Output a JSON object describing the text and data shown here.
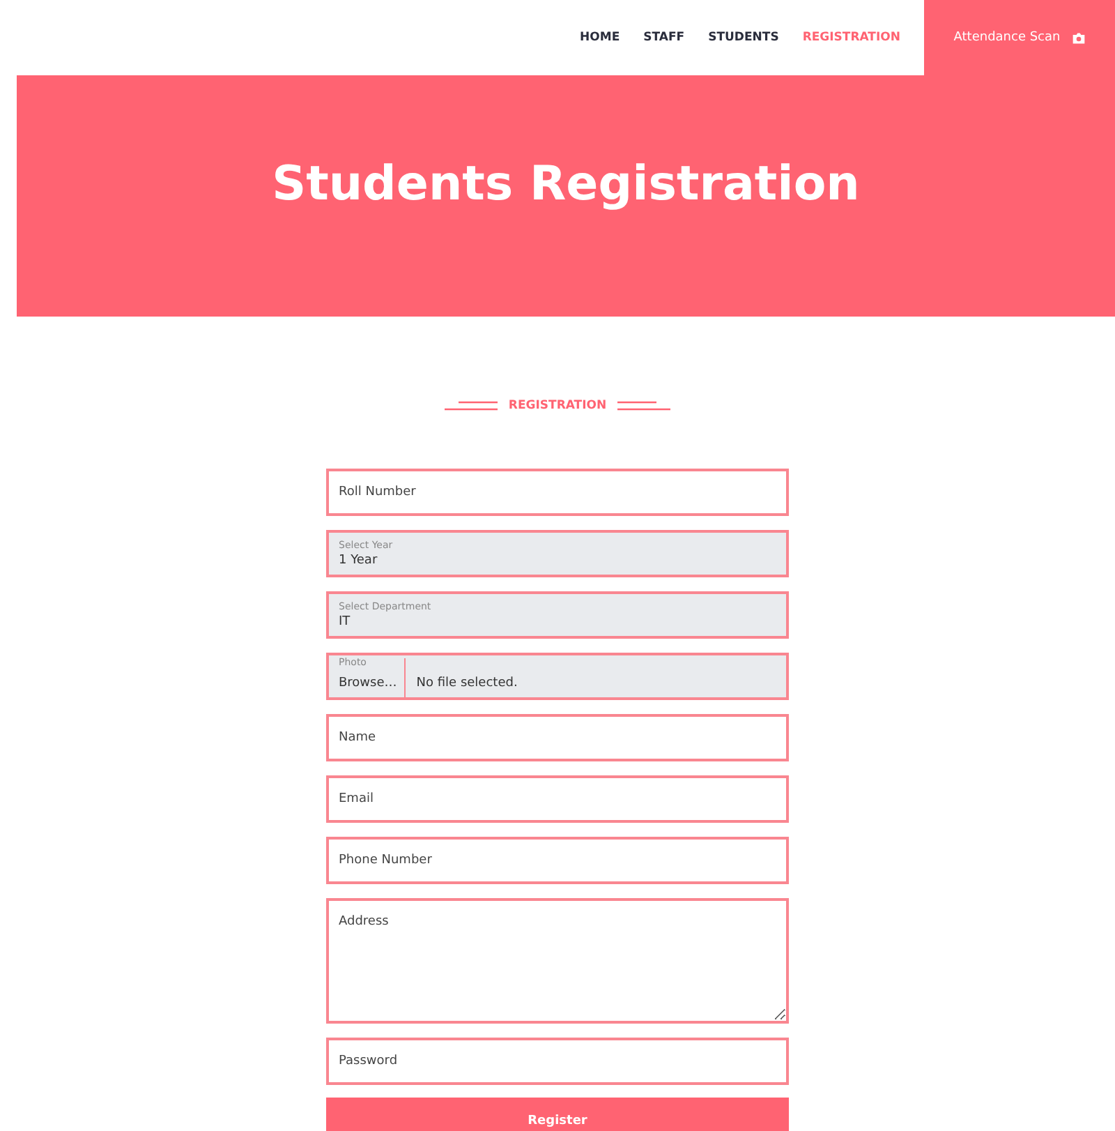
{
  "nav": {
    "items": [
      {
        "label": "HOME",
        "selected": false
      },
      {
        "label": "STAFF",
        "selected": false
      },
      {
        "label": "STUDENTS",
        "selected": false
      },
      {
        "label": "REGISTRATION",
        "selected": true
      }
    ],
    "action": "Attendance Scan"
  },
  "hero": {
    "title": "Students Registration"
  },
  "section_title": "REGISTRATION",
  "form": {
    "fields": [
      {
        "kind": "text",
        "placeholder": "Roll Number"
      },
      {
        "kind": "select",
        "label": "Select Year",
        "value": "1 Year"
      },
      {
        "kind": "select",
        "label": "Select Department",
        "value": "IT"
      },
      {
        "kind": "file",
        "label": "Photo",
        "button": "Browse…",
        "status": "No file selected."
      },
      {
        "kind": "text",
        "placeholder": "Name"
      },
      {
        "kind": "text",
        "placeholder": "Email"
      },
      {
        "kind": "text",
        "placeholder": "Phone Number"
      },
      {
        "kind": "textarea",
        "placeholder": "Address"
      },
      {
        "kind": "text",
        "placeholder": "Password"
      }
    ],
    "submit": "Register"
  }
}
